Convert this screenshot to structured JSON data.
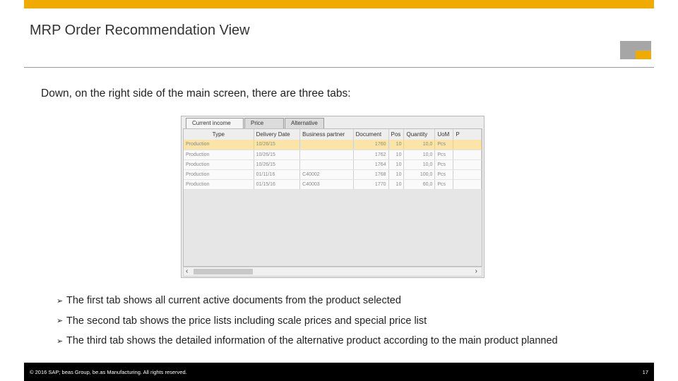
{
  "slide": {
    "title": "MRP Order Recommendation View",
    "intro": "Down, on the right side of the main screen, there are three tabs:",
    "bullets": [
      "The first tab shows all current active documents from the product selected",
      "The second tab shows the price lists including scale prices and special price list",
      "The third tab shows the detailed information of the alternative product according to the main product planned"
    ],
    "footer": "© 2016 SAP; beas Group, be.as Manufacturing.  All rights reserved.",
    "page_number": "17",
    "colors": {
      "accent": "#f0ab00",
      "logo_gray": "#a6a6a6"
    }
  },
  "window": {
    "tabs": [
      "Current income",
      "Price",
      "Alternative"
    ],
    "columns": [
      "Type",
      "Delivery Date",
      "Business partner",
      "Document",
      "Pos",
      "Quantity",
      "UoM",
      "P"
    ],
    "rows": [
      [
        "Production",
        "10/26/15",
        "",
        "1760",
        "10",
        "10,0",
        "Pcs"
      ],
      [
        "Production",
        "10/26/15",
        "",
        "1762",
        "10",
        "10,0",
        "Pcs"
      ],
      [
        "Production",
        "10/26/15",
        "",
        "1764",
        "10",
        "10,0",
        "Pcs"
      ],
      [
        "Production",
        "01/11/16",
        "C40002",
        "1768",
        "10",
        "100,0",
        "Pcs"
      ],
      [
        "Production",
        "01/15/16",
        "C40003",
        "1770",
        "10",
        "60,0",
        "Pcs"
      ]
    ],
    "selected_row": 0
  }
}
